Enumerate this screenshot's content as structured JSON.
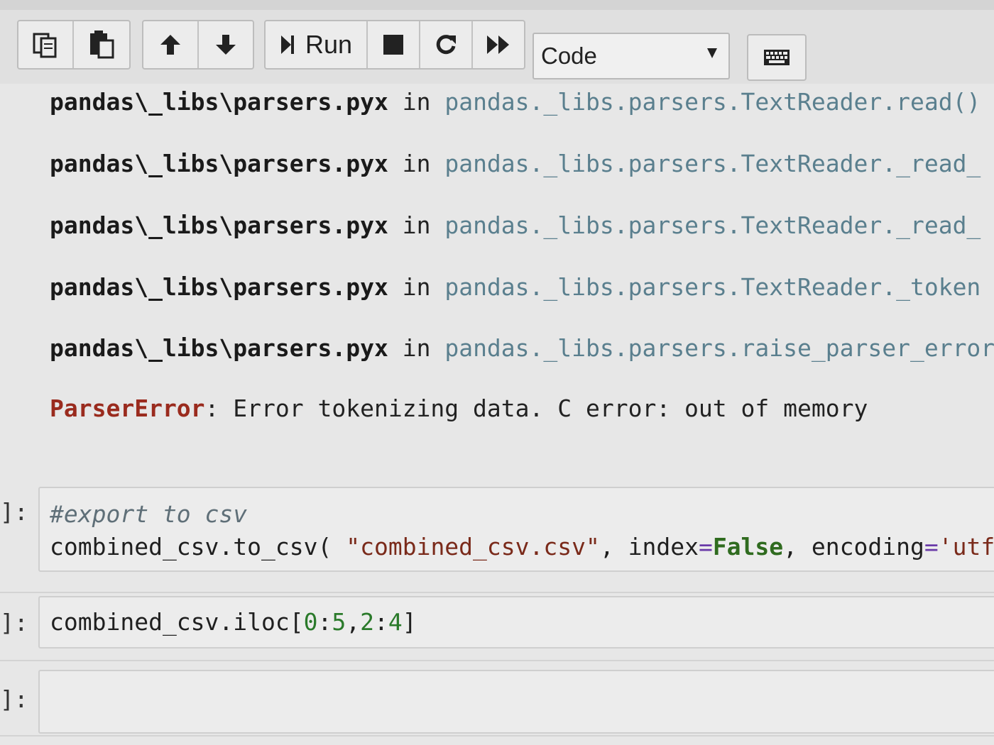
{
  "toolbar": {
    "run_label": "Run",
    "cell_type": "Code",
    "icons": {
      "copy": "copy-icon",
      "paste": "paste-icon",
      "move_up": "arrow-up-icon",
      "move_down": "arrow-down-icon",
      "run": "step-icon",
      "stop": "stop-icon",
      "restart": "restart-icon",
      "run_all": "fast-forward-icon",
      "keyboard": "keyboard-icon"
    }
  },
  "traceback": {
    "frames": [
      {
        "file": "pandas\\_libs\\parsers.pyx",
        "in": "in",
        "func": "pandas._libs.parsers.TextReader.read()"
      },
      {
        "file": "pandas\\_libs\\parsers.pyx",
        "in": "in",
        "func": "pandas._libs.parsers.TextReader._read_"
      },
      {
        "file": "pandas\\_libs\\parsers.pyx",
        "in": "in",
        "func": "pandas._libs.parsers.TextReader._read_"
      },
      {
        "file": "pandas\\_libs\\parsers.pyx",
        "in": "in",
        "func": "pandas._libs.parsers.TextReader._token"
      },
      {
        "file": "pandas\\_libs\\parsers.pyx",
        "in": "in",
        "func": "pandas._libs.parsers.raise_parser_error"
      }
    ],
    "error_name": "ParserError",
    "error_message": ": Error tokenizing data. C error: out of memory"
  },
  "cells": [
    {
      "prompt": "]:",
      "comment": "#export to csv",
      "code_prefix": "combined_csv.to_csv( ",
      "code_string": "\"combined_csv.csv\"",
      "code_mid": ", index",
      "code_eq1": "=",
      "code_kw": "False",
      "code_mid2": ", encoding",
      "code_eq2": "=",
      "code_tail": "'utf"
    },
    {
      "prompt": "]:",
      "code_a": "combined_csv.iloc[",
      "code_n0": "0",
      "code_b": ":",
      "code_n5": "5",
      "code_c": ",",
      "code_n2": "2",
      "code_d": ":",
      "code_n4": "4",
      "code_e": "]"
    },
    {
      "prompt": "]:"
    }
  ],
  "colors": {
    "error_name": "#9a2b1e",
    "func_link": "#5a7f8e",
    "keyword": "#2f6b1f",
    "string": "#7a2a1a"
  }
}
